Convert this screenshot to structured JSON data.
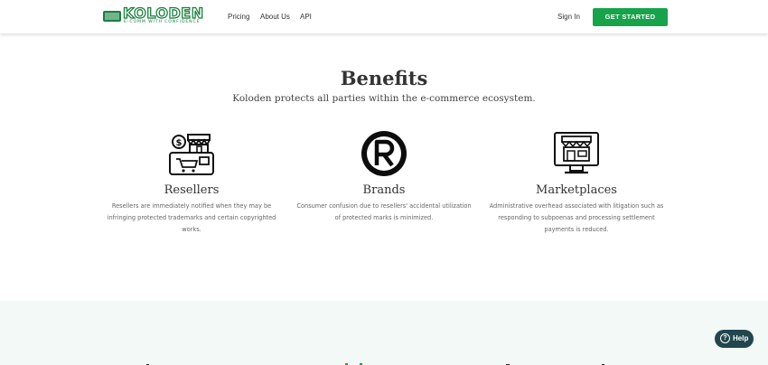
{
  "brand": {
    "name": "KOLODEN",
    "tagline": "E-COMM WITH CONFIDENCE"
  },
  "nav": {
    "links": [
      "Pricing",
      "About Us",
      "API"
    ],
    "signin_label": "Sign In",
    "cta_label": "GET STARTED"
  },
  "benefits": {
    "title": "Benefits",
    "subtitle": "Koloden protects all parties within the e-commerce ecosystem.",
    "items": [
      {
        "title": "Resellers",
        "text": "Resellers are immediately notified when they may be infringing protected trademarks and certain copyrighted works.",
        "icon": "store-dollar-icon"
      },
      {
        "title": "Brands",
        "text": "Consumer confusion due to resellers' accidental utilization of protected marks is minimized.",
        "icon": "registered-trademark-icon"
      },
      {
        "title": "Marketplaces",
        "text": "Administrative overhead associated with litigation such as responding to subpoenas and processing settlement payments is reduced.",
        "icon": "online-store-monitor-icon"
      }
    ]
  },
  "help": {
    "label": "Help"
  },
  "colors": {
    "brand_green": "#17803d",
    "cta_green": "#16a34a",
    "help_bg": "#21464d",
    "section_bg": "#f3f9f6"
  }
}
